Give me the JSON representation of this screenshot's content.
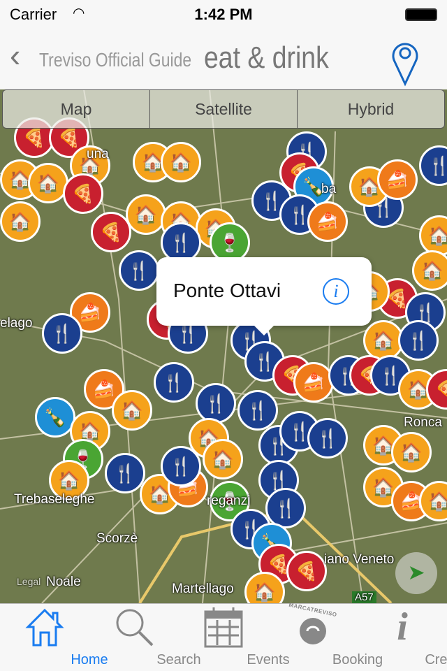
{
  "status": {
    "carrier": "Carrier",
    "time": "1:42 PM"
  },
  "nav": {
    "back_label": "Treviso Official Guide",
    "title": "eat & drink",
    "accent": "#1565c0"
  },
  "map_type": {
    "options": [
      "Map",
      "Satellite",
      "Hybrid"
    ]
  },
  "map": {
    "labels": [
      "una",
      "ba",
      "elago",
      "Ronca",
      "Trebaseleghe",
      "Scorzè",
      "Noale",
      "Martellago",
      "reganzi",
      "iano Veneto",
      "A57",
      "Legal"
    ],
    "marker_categories": [
      {
        "name": "restaurant",
        "color": "#1b3f8f",
        "glyph": "🍴"
      },
      {
        "name": "pizzeria",
        "color": "#c8202f",
        "glyph": "🍕"
      },
      {
        "name": "agriturismo",
        "color": "#f5a21b",
        "glyph": "🏠"
      },
      {
        "name": "pastry",
        "color": "#ef7a1a",
        "glyph": "🍰"
      },
      {
        "name": "wine-bar",
        "color": "#4aa533",
        "glyph": "🍷"
      },
      {
        "name": "winery",
        "color": "#1e8fd6",
        "glyph": "🍾"
      }
    ]
  },
  "callout": {
    "name": "Ponte Ottavi"
  },
  "tabs": [
    {
      "label": "Home",
      "active": true
    },
    {
      "label": "Search"
    },
    {
      "label": "Events"
    },
    {
      "label": "Booking"
    },
    {
      "label": "Credits"
    }
  ],
  "booking_logo_text": "MARCATREVISO"
}
